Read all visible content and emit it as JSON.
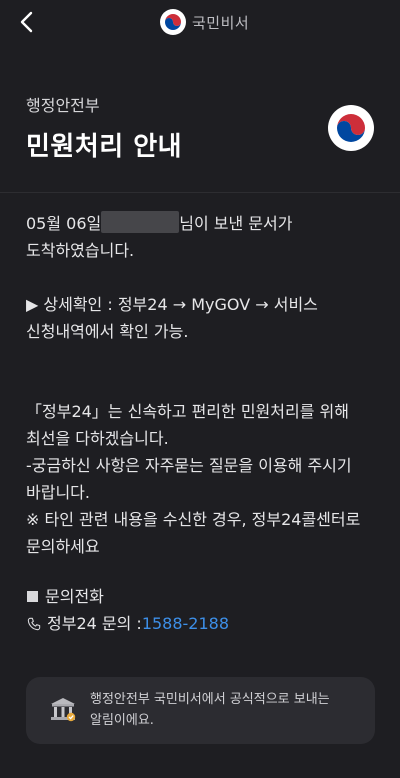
{
  "header": {
    "back_icon": "chevron-left-icon",
    "app_name": "국민비서",
    "logo": "korea-government-emblem"
  },
  "message": {
    "sender": "행정안전부",
    "title": "민원처리 안내",
    "line1_prefix": "05월 06일",
    "line1_suffix": "님이 보낸 문서가",
    "line2": "도착하였습니다.",
    "detail_line1": "▶ 상세확인 : 정부24 → MyGOV → 서비스",
    "detail_line2": "신청내역에서 확인 가능.",
    "notice_line1": "「정부24」는 신속하고 편리한 민원처리를 위해",
    "notice_line2": "최선을 다하겠습니다.",
    "notice_line3": "-궁금하신 사항은 자주묻는 질문을 이용해 주시기",
    "notice_line4": "바랍니다.",
    "notice_line5": "※ 타인 관련 내용을 수신한 경우, 정부24콜센터로",
    "notice_line6": "문의하세요",
    "contact_heading": "문의전화",
    "contact_label": "정부24 문의 : ",
    "contact_phone": "1588-2188"
  },
  "footer": {
    "line1": "행정안전부 국민비서에서 공식적으로 보내는",
    "line2": "알림이에요.",
    "icon": "government-building-icon"
  },
  "colors": {
    "background": "#1e1e22",
    "link": "#3d8fe8",
    "card": "#2c2c31",
    "emblem_red": "#cd2e3a",
    "emblem_blue": "#0047a0"
  }
}
